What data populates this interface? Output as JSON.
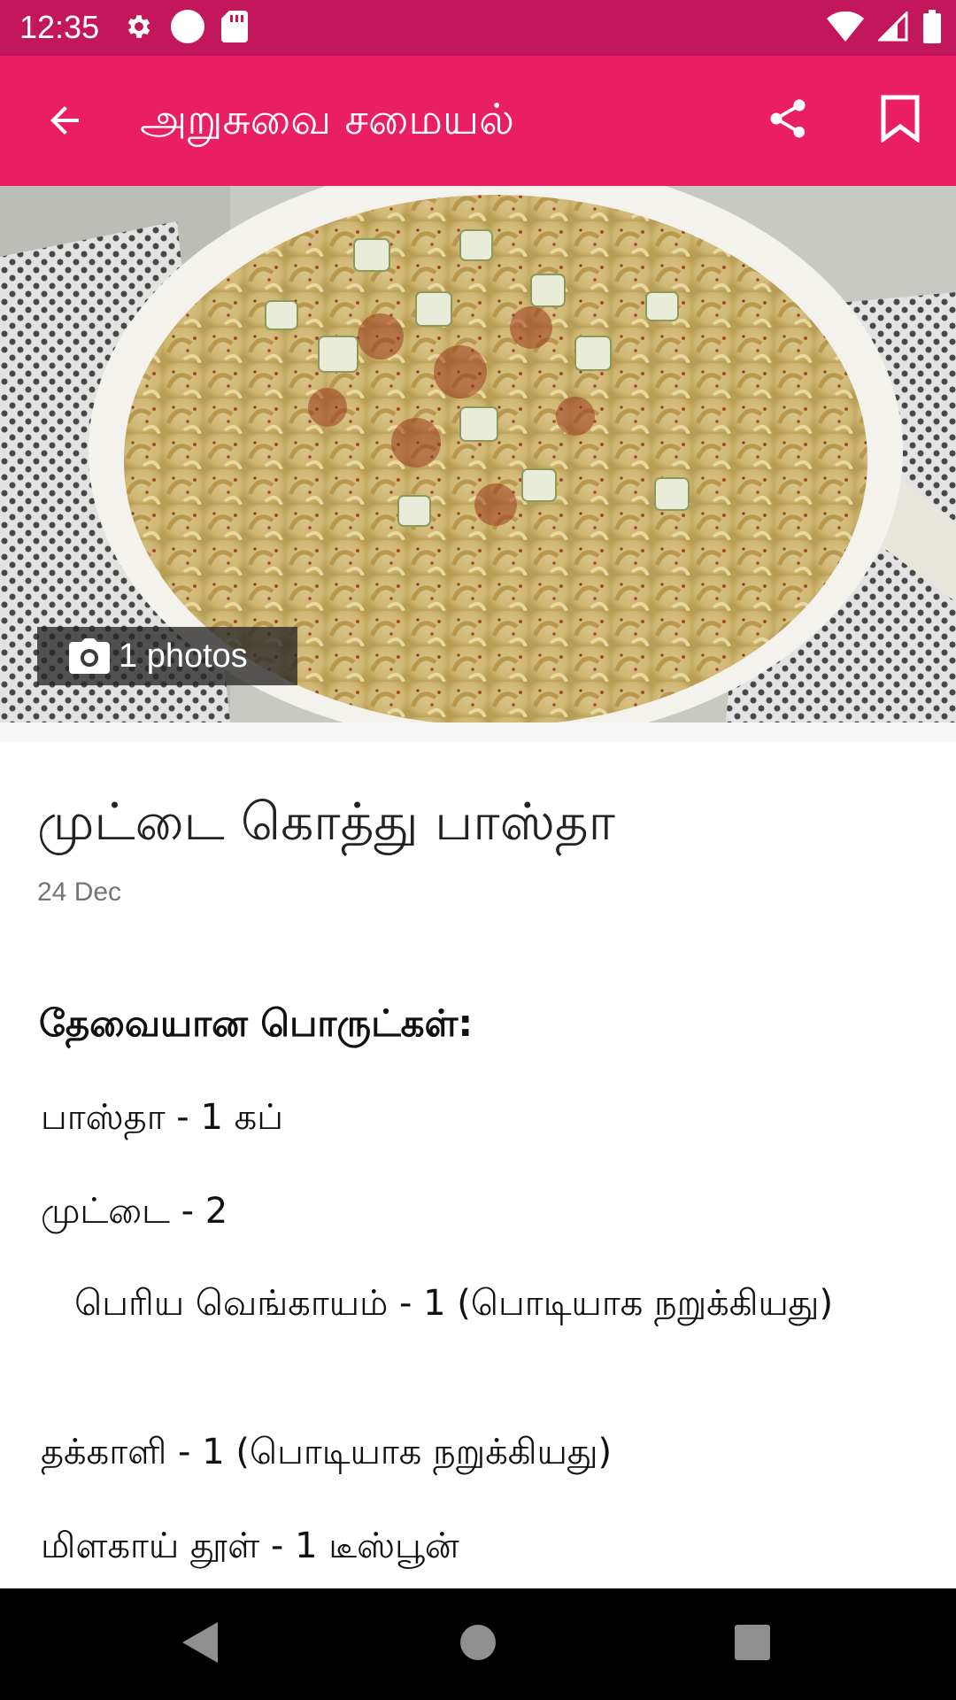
{
  "status_bar": {
    "time": "12:35",
    "left_icons": [
      "gear-icon",
      "circle-icon",
      "sd-card-icon"
    ],
    "right_icons": [
      "wifi-icon",
      "cell-signal-icon",
      "battery-icon"
    ]
  },
  "app_bar": {
    "title": "அறுசுவை சமையல்",
    "back_icon": "arrow-left-icon",
    "share_icon": "share-icon",
    "bookmark_icon": "bookmark-icon",
    "color": "#e91e63",
    "status_color": "#c2185b"
  },
  "hero": {
    "photo_icon": "camera-icon",
    "photo_count_label": "1 photos"
  },
  "article": {
    "title": "முட்டை கொத்து பாஸ்தா",
    "date": "24 Dec",
    "section_heading": "தேவையான பொருட்கள்:",
    "ingredients": [
      " பாஸ்தா - 1 கப்",
      " முட்டை - 2",
      "   பெரிய வெங்காயம் - 1 (பொடியாக நறுக்கியது)",
      " தக்காளி - 1 (பொடியாக நறுக்கியது)",
      " மிளகாய் தூள் - 1 டீஸ்பூன்"
    ]
  },
  "nav_bar": {
    "back_icon": "triangle-back-icon",
    "home_icon": "circle-home-icon",
    "recents_icon": "square-recents-icon"
  }
}
